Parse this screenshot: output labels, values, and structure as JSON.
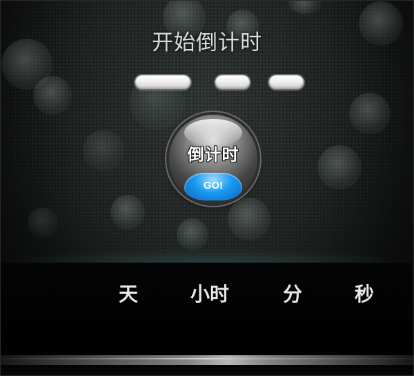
{
  "title": "开始倒计时",
  "countdown_inputs": {
    "days": "",
    "hours": "",
    "minutes": ""
  },
  "go_button": {
    "label": "倒计时",
    "badge": "GO!"
  },
  "units": {
    "day": "天",
    "hour": "小时",
    "minute": "分",
    "second": "秒"
  },
  "colors": {
    "badge_blue": "#1a9bf0",
    "text": "#e8e8e8",
    "background": "#1b1f1e"
  }
}
